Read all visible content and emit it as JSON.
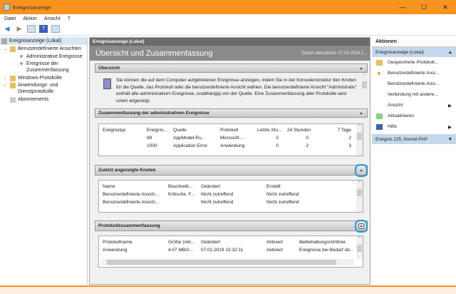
{
  "window": {
    "title": "Ereignisanzeige",
    "minimize": "—",
    "maximize": "☐",
    "close": "✕"
  },
  "menu": [
    "Datei",
    "Aktion",
    "Ansicht",
    "?"
  ],
  "tree": [
    "Ereignisanzeige (Lokal)",
    "Benutzerdefinierte Ansichten",
    "Administrative Ereignisse",
    "Ereignisse der Zusammenfassung",
    "Windows-Protokolle",
    "Anwendungs- und Dienstprotokolle",
    "Abonnements"
  ],
  "center": {
    "header": "Ereignisanzeige (Lokal)",
    "title": "Übersicht und Zusammenfassung",
    "updated": "Zuletzt aktualisiert: 07.02.2019 1...",
    "overview": {
      "title": "Übersicht",
      "text": "Sie können die auf dem Computer aufgetretenen Ereignisse anzeigen, indem Sie in der Konsolenstruktur den Knoten für die Quelle, das Protokoll oder die benutzerdefinierte Ansicht wählen. Die benutzerdefinierte Ansicht \"Administrativ\" enthält alle administrativen Ereignisse, unabhängig von der Quelle. Eine Zusammenfassung aller Protokolle wird unten angezeigt."
    },
    "admin": {
      "title": "Zusammenfassung der administrativen Ereignisse",
      "columns": [
        "Ereignistyp",
        "Ereignis...",
        "Quelle",
        "Protokoll",
        "Letzte Stu...",
        "24 Stunden",
        "7 Tage"
      ],
      "rows": [
        [
          "",
          "69",
          "AppModel-Ru...",
          "Microsoft-...",
          "0",
          "0",
          "2"
        ],
        [
          "",
          "1000",
          "Application Error",
          "Anwendung",
          "0",
          "2",
          "3"
        ]
      ]
    },
    "recent": {
      "title": "Zuletzt angezeigte Knoten",
      "columns": [
        "Name",
        "Beschreib...",
        "Geändert",
        "Erstellt"
      ],
      "rows": [
        [
          "Benutzerdefinierte Ansich...",
          "Kritische, F...",
          "Nicht zutreffend",
          "Nicht zutreffend"
        ],
        [
          "Benutzerdefinierte Ansich...",
          "",
          "Nicht zutreffend",
          "Nicht zutreffend"
        ]
      ]
    },
    "logs": {
      "title": "Protokollzusammenfassung",
      "columns": [
        "Protokollname",
        "Größe (Akt...",
        "Geändert",
        "Aktiviert",
        "Beibehaltungsrichtlinie"
      ],
      "rows": [
        [
          "Anwendung",
          "4.07 MB/2...",
          "07.02.2019 15:32:11",
          "Aktiviert",
          "Ereignisse bei Bedarf üb..."
        ]
      ]
    }
  },
  "actions": {
    "title": "Aktionen",
    "group1": "Ereignisanzeige (Lokal)",
    "items": [
      "Gespeicherte Protokoll...",
      "Benutzerdefinierte Ansi...",
      "Benutzerdefinierte Ansi...",
      "Verbindung mit andere...",
      "Ansicht",
      "Aktualisieren",
      "Hilfe"
    ],
    "group2": "Ereignis 225, Kernel-PnP"
  },
  "colors": {
    "titlebar": "#f7931e",
    "highlight": "#1e9ad6"
  }
}
